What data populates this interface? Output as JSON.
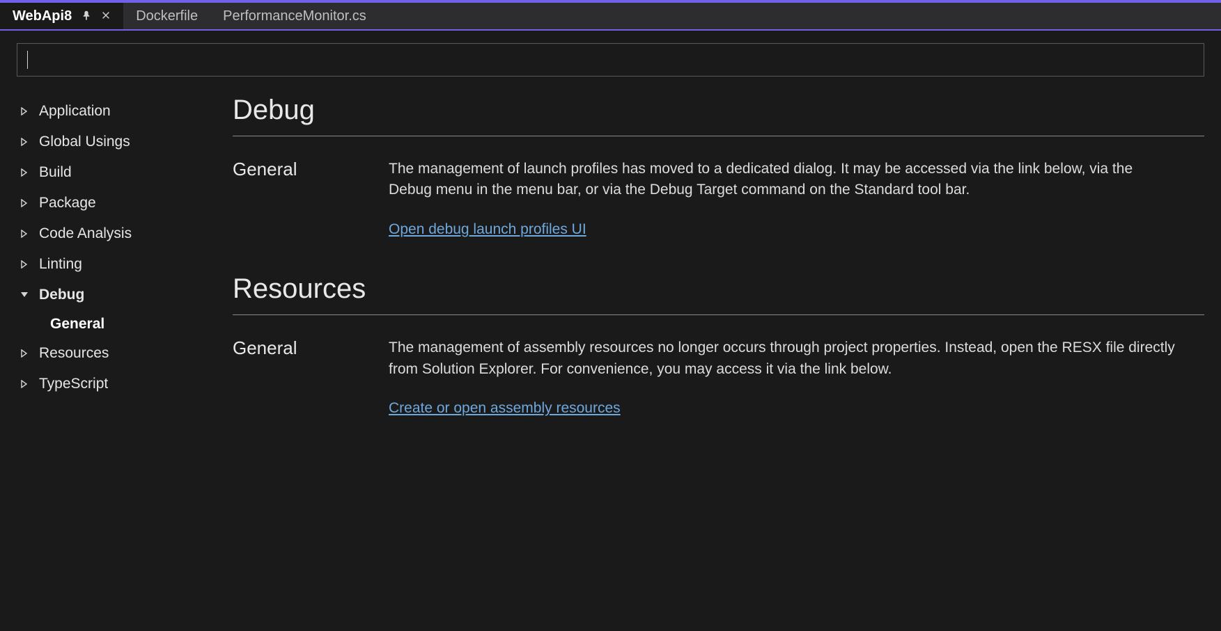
{
  "tabs": [
    {
      "label": "WebApi8",
      "active": true
    },
    {
      "label": "Dockerfile",
      "active": false
    },
    {
      "label": "PerformanceMonitor.cs",
      "active": false
    }
  ],
  "search": {
    "value": ""
  },
  "sidebar": {
    "items": [
      {
        "label": "Application",
        "expanded": false
      },
      {
        "label": "Global Usings",
        "expanded": false
      },
      {
        "label": "Build",
        "expanded": false
      },
      {
        "label": "Package",
        "expanded": false
      },
      {
        "label": "Code Analysis",
        "expanded": false
      },
      {
        "label": "Linting",
        "expanded": false
      },
      {
        "label": "Debug",
        "expanded": true,
        "children": [
          {
            "label": "General"
          }
        ]
      },
      {
        "label": "Resources",
        "expanded": false
      },
      {
        "label": "TypeScript",
        "expanded": false
      }
    ]
  },
  "sections": {
    "debug": {
      "title": "Debug",
      "general_label": "General",
      "general_text": "The management of launch profiles has moved to a dedicated dialog. It may be accessed via the link below, via the Debug menu in the menu bar, or via the Debug Target command on the Standard tool bar.",
      "link": "Open debug launch profiles UI"
    },
    "resources": {
      "title": "Resources",
      "general_label": "General",
      "general_text": "The management of assembly resources no longer occurs through project properties. Instead, open the RESX file directly from Solution Explorer. For convenience, you may access it via the link below.",
      "link": "Create or open assembly resources"
    }
  }
}
